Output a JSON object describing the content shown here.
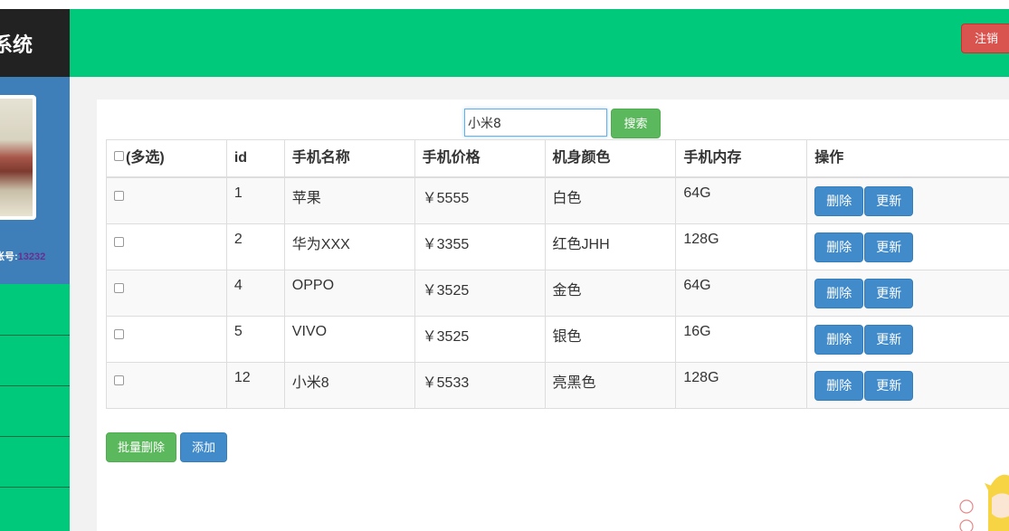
{
  "app": {
    "title_fragment": "系统"
  },
  "header": {
    "logout_label": "注销"
  },
  "sidebar": {
    "account_label": "账号:",
    "account_value": "13232"
  },
  "search": {
    "value": "小米8",
    "button_label": "搜索"
  },
  "table": {
    "headers": [
      "(多选)",
      "id",
      "手机名称",
      "手机价格",
      "机身颜色",
      "手机内存",
      "操作"
    ],
    "rows": [
      {
        "id": "1",
        "name": "苹果",
        "price": "￥5555",
        "color": "白色",
        "memory": "64G"
      },
      {
        "id": "2",
        "name": "华为XXX",
        "price": "￥3355",
        "color": "红色JHH",
        "memory": "128G"
      },
      {
        "id": "4",
        "name": "OPPO",
        "price": "￥3525",
        "color": "金色",
        "memory": "64G"
      },
      {
        "id": "5",
        "name": "VIVO",
        "price": "￥3525",
        "color": "银色",
        "memory": "16G"
      },
      {
        "id": "12",
        "name": "小米8",
        "price": "￥5533",
        "color": "亮黑色",
        "memory": "128G"
      }
    ],
    "delete_label": "删除",
    "update_label": "更新"
  },
  "footer_buttons": {
    "batch_delete_label": "批量删除",
    "add_label": "添加"
  },
  "colors": {
    "header_green": "#00c97b",
    "profile_blue": "#3f7fb9",
    "logo_dark": "#222222",
    "danger": "#d9534f",
    "primary": "#428bca",
    "success": "#5cb85c"
  }
}
